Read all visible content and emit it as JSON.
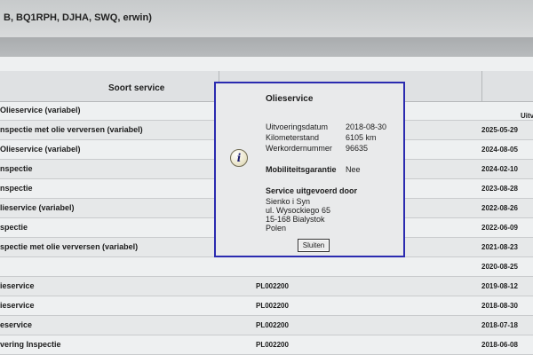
{
  "breadcrumb": "B, BQ1RPH, DJHA, SWQ, erwin)",
  "table": {
    "col_service": "Soort service",
    "col_date": "Uitv",
    "rows": [
      {
        "service": "Olieservice (variabel)",
        "order": "",
        "date": ""
      },
      {
        "service": "nspectie met olie verversen (variabel)",
        "order": "",
        "date": "2025-05-29"
      },
      {
        "service": "Olieservice (variabel)",
        "order": "",
        "date": "2024-08-05"
      },
      {
        "service": "nspectie",
        "order": "",
        "date": "2024-02-10"
      },
      {
        "service": "nspectie",
        "order": "",
        "date": "2023-08-28"
      },
      {
        "service": "lieservice (variabel)",
        "order": "",
        "date": "2022-08-26"
      },
      {
        "service": "spectie",
        "order": "",
        "date": "2022-06-09"
      },
      {
        "service": "spectie met olie verversen (variabel)",
        "order": "",
        "date": "2021-08-23"
      },
      {
        "service": "",
        "order": "",
        "date": "2020-08-25"
      },
      {
        "service": "ieservice",
        "order": "PL002200",
        "date": "2019-08-12"
      },
      {
        "service": "ieservice",
        "order": "PL002200",
        "date": "2018-08-30"
      },
      {
        "service": "eservice",
        "order": "PL002200",
        "date": "2018-07-18"
      },
      {
        "service": "vering Inspectie",
        "order": "PL002200",
        "date": "2018-06-08"
      }
    ]
  },
  "dialog": {
    "title": "Olieservice",
    "icon": "info-icon",
    "fields": [
      {
        "label": "Uitvoeringsdatum",
        "value": "2018-08-30"
      },
      {
        "label": "Kilometerstand",
        "value": "6105 km"
      },
      {
        "label": "Werkordernummer",
        "value": "96635"
      }
    ],
    "mobility_label": "Mobiliteitsgarantie",
    "mobility_value": "Nee",
    "service_by_label": "Service uitgevoerd door",
    "address": [
      "Sienko i Syn",
      "ul. Wysockiego 65",
      "15-168 Bialystok",
      "Polen"
    ],
    "close_label": "Sluiten"
  }
}
